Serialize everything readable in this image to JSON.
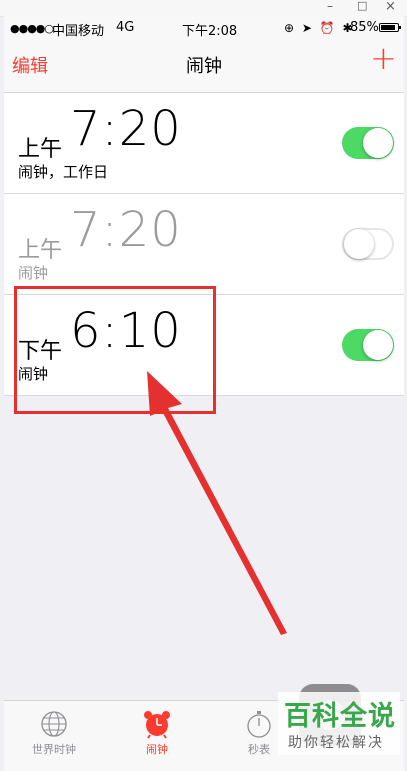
{
  "window": {
    "minimize": "–",
    "maximize": "□",
    "close": "×"
  },
  "status_bar": {
    "signal": "●●●●○",
    "carrier": "中国移动",
    "network": "4G",
    "time": "下午2:08",
    "icons": "⊕ ➤ ⏰ ✱",
    "battery": "85%"
  },
  "nav": {
    "edit": "编辑",
    "title": "闹钟",
    "add": "+"
  },
  "alarms": [
    {
      "ampm": "上午",
      "time": "7:20",
      "label": "闹钟，工作日",
      "enabled": true
    },
    {
      "ampm": "上午",
      "time": "7:20",
      "label": "闹钟",
      "enabled": false
    },
    {
      "ampm": "下午",
      "time": "6:10",
      "label": "闹钟",
      "enabled": true
    }
  ],
  "tabs": [
    {
      "label": "世界时钟",
      "icon": "globe-icon"
    },
    {
      "label": "闹钟",
      "icon": "alarm-clock-icon",
      "active": true
    },
    {
      "label": "秒表",
      "icon": "stopwatch-icon"
    }
  ],
  "colors": {
    "accent": "#ff3b30",
    "toggle_on": "#4cd964",
    "annotation": "#e53030"
  },
  "watermark": {
    "main": "百科全说",
    "sub": "助你轻松解决"
  }
}
